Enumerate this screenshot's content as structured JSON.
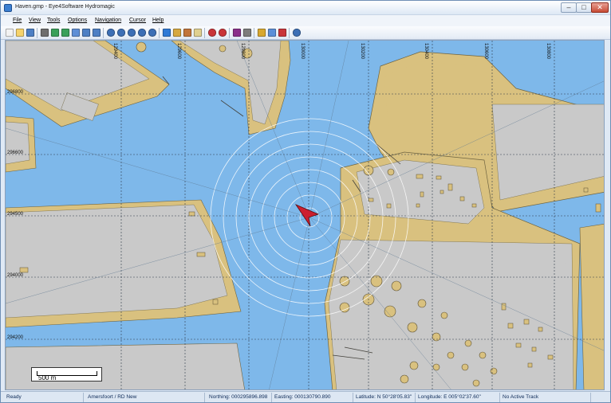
{
  "window": {
    "title": "Haven.gmp - Eye4Software Hydromagic"
  },
  "caption": {
    "minimize": "–",
    "maximize": "□",
    "close": "✕"
  },
  "menu": [
    "File",
    "View",
    "Tools",
    "Options",
    "Navigation",
    "Cursor",
    "Help"
  ],
  "toolbar": {
    "icons": [
      "new-file-icon",
      "open-folder-icon",
      "save-icon",
      "print-icon",
      "import-icon",
      "export-icon",
      "layers-icon",
      "grid-icon",
      "table-icon",
      "info-icon",
      "zoom-in-icon",
      "zoom-out-icon",
      "zoom-window-icon",
      "zoom-all-icon",
      "pan-icon",
      "route-icon",
      "measure-icon",
      "note-icon",
      "record-icon",
      "stop-record-icon",
      "cut-icon",
      "stop-icon",
      "lock-icon",
      "connect-icon",
      "disconnect-icon",
      "help-icon"
    ]
  },
  "map": {
    "grid_labels_top": [
      "129400",
      "129600",
      "129800",
      "130000",
      "130200",
      "130400",
      "130600",
      "130800"
    ],
    "grid_labels_left": [
      "296800",
      "296600",
      "294500",
      "294000",
      "294200"
    ],
    "colors": {
      "water": "#7eb8ea",
      "land": "#d9c17f",
      "built": "#c9c9c9",
      "vessel": "#cc1f2f"
    },
    "scale_label": "500 m"
  },
  "status": {
    "state": "Ready",
    "projection": "Amersfoort / RD New",
    "northing": "Northing: 000295896.898",
    "easting": "Easting: 000130790.890",
    "latitude": "Latitude: N 50°28'05.83\"",
    "longitude": "Longitude: E 005°02'37.60\"",
    "track": "No Active Track"
  }
}
